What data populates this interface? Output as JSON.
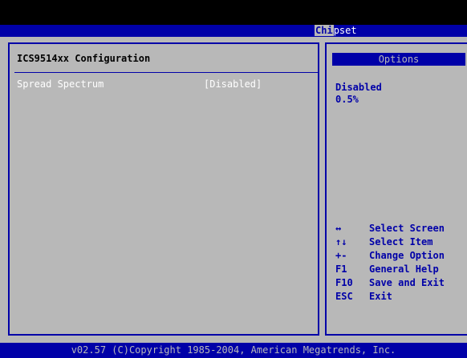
{
  "header": {
    "tab_highlight": "Chi",
    "tab_rest": "pset"
  },
  "left": {
    "section_title": "ICS9514xx Configuration",
    "items": [
      {
        "label": "Spread Spectrum",
        "value": "[Disabled]"
      }
    ]
  },
  "right": {
    "options_title": "Options",
    "options": [
      "Disabled",
      "0.5%"
    ],
    "help": [
      {
        "key": "↔",
        "desc": "Select Screen"
      },
      {
        "key": "↑↓",
        "desc": "Select Item"
      },
      {
        "key": "+-",
        "desc": "Change Option"
      },
      {
        "key": "F1",
        "desc": "General Help"
      },
      {
        "key": "F10",
        "desc": "Save and Exit"
      },
      {
        "key": "ESC",
        "desc": "Exit"
      }
    ]
  },
  "footer": {
    "text": "v02.57 (C)Copyright 1985-2004, American Megatrends, Inc."
  },
  "colors": {
    "background": "#0000a8",
    "panel": "#b8b8b8",
    "selected_text": "#ffffff"
  }
}
